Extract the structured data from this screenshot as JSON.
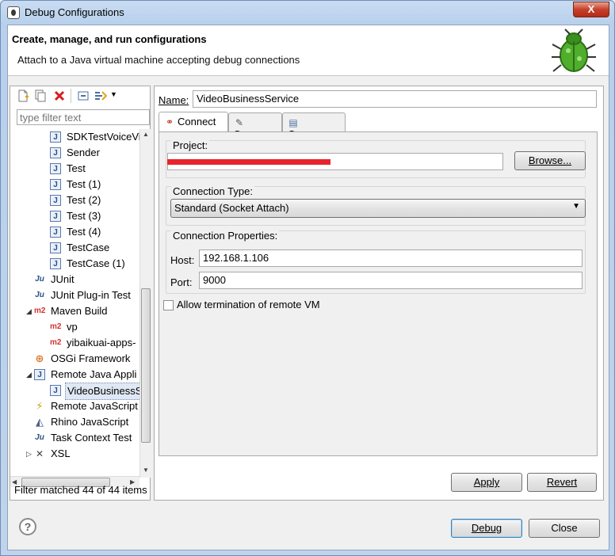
{
  "window": {
    "title": "Debug Configurations",
    "close_glyph": "X"
  },
  "header": {
    "title": "Create, manage, and run configurations",
    "description": "Attach to a Java virtual machine accepting debug connections"
  },
  "filter": {
    "placeholder": "type filter text",
    "status": "Filter matched 44 of 44 items"
  },
  "tree": {
    "items": [
      {
        "label": "SDKTestVoiceVi",
        "icon": "java-class-icon"
      },
      {
        "label": "Sender",
        "icon": "java-class-icon"
      },
      {
        "label": "Test",
        "icon": "java-class-icon"
      },
      {
        "label": "Test (1)",
        "icon": "java-class-icon"
      },
      {
        "label": "Test (2)",
        "icon": "java-class-icon"
      },
      {
        "label": "Test (3)",
        "icon": "java-class-icon"
      },
      {
        "label": "Test (4)",
        "icon": "java-class-icon"
      },
      {
        "label": "TestCase",
        "icon": "java-class-icon"
      },
      {
        "label": "TestCase (1)",
        "icon": "java-class-icon"
      },
      {
        "label": "JUnit",
        "icon": "junit-icon"
      },
      {
        "label": "JUnit Plug-in Test",
        "icon": "junit-plugin-icon"
      },
      {
        "label": "Maven Build",
        "icon": "maven-icon"
      },
      {
        "label": "vp",
        "icon": "maven-icon"
      },
      {
        "label": "yibaikuai-apps-",
        "icon": "maven-icon"
      },
      {
        "label": "OSGi Framework",
        "icon": "osgi-icon"
      },
      {
        "label": "Remote Java Appli",
        "icon": "remote-java-icon"
      },
      {
        "label": "VideoBusinessS",
        "icon": "remote-java-icon"
      },
      {
        "label": "Remote JavaScript",
        "icon": "remote-js-icon"
      },
      {
        "label": "Rhino JavaScript",
        "icon": "rhino-icon"
      },
      {
        "label": "Task Context Test",
        "icon": "task-context-icon"
      },
      {
        "label": "XSL",
        "icon": "xsl-icon"
      }
    ]
  },
  "config": {
    "name_label": "Name:",
    "name_value": "VideoBusinessService",
    "tabs": [
      {
        "label": "Connect",
        "icon": "connect-icon"
      },
      {
        "label": "Source",
        "icon": "source-icon"
      },
      {
        "label": "Common",
        "icon": "common-icon"
      }
    ],
    "project_label": "Project:",
    "browse_label": "Browse...",
    "connection_type_label": "Connection Type:",
    "connection_type_value": "Standard (Socket Attach)",
    "connection_props_label": "Connection Properties:",
    "host_label": "Host:",
    "host_value": "192.168.1.106",
    "port_label": "Port:",
    "port_value": "9000",
    "allow_termination_label": "Allow termination of remote VM",
    "allow_termination_checked": false,
    "apply_label": "Apply",
    "revert_label": "Revert"
  },
  "footer": {
    "help_glyph": "?",
    "debug_label": "Debug",
    "close_label": "Close"
  },
  "colors": {
    "redaction": "#e8232c",
    "title_gradient": "#c9dcf2",
    "close_button": "#c7402a"
  }
}
